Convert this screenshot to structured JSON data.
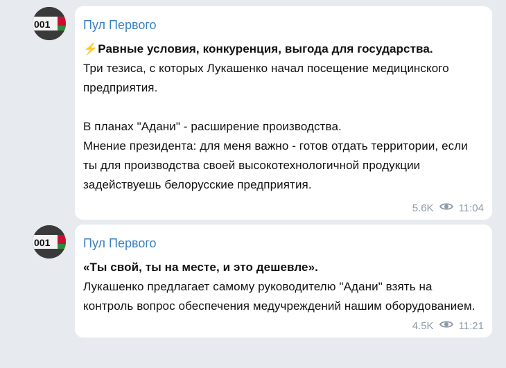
{
  "posts": [
    {
      "author": "Пул Первого",
      "avatar_plate": "001",
      "lead_icon": "⚡",
      "lead": "Равные условия, конкуренция, выгода для государства.",
      "lines": [
        "Три тезиса, с которых Лукашенко начал посещение медицинского предприятия."
      ],
      "lines2": [
        "В планах \"Адани\" - расширение производства.",
        "Мнение президента: для меня важно - готов отдать территории, если ты для производства своей высокотехнологичной продукции задействуешь белорусские предприятия."
      ],
      "views": "5.6K",
      "time": "11:04"
    },
    {
      "author": "Пул Первого",
      "avatar_plate": "001",
      "lead": "«Ты свой, ты на месте, и это дешевле».",
      "lines": [
        "Лукашенко предлагает самому руководителю \"Адани\" взять на контроль вопрос обеспечения медучреждений нашим оборудованием."
      ],
      "views": "4.5K",
      "time": "11:21"
    }
  ],
  "colors": {
    "background": "#e7ebf0",
    "bubble": "#ffffff",
    "author": "#3a80bf",
    "meta": "#8d9aa8",
    "bolt": "#f0b400"
  }
}
